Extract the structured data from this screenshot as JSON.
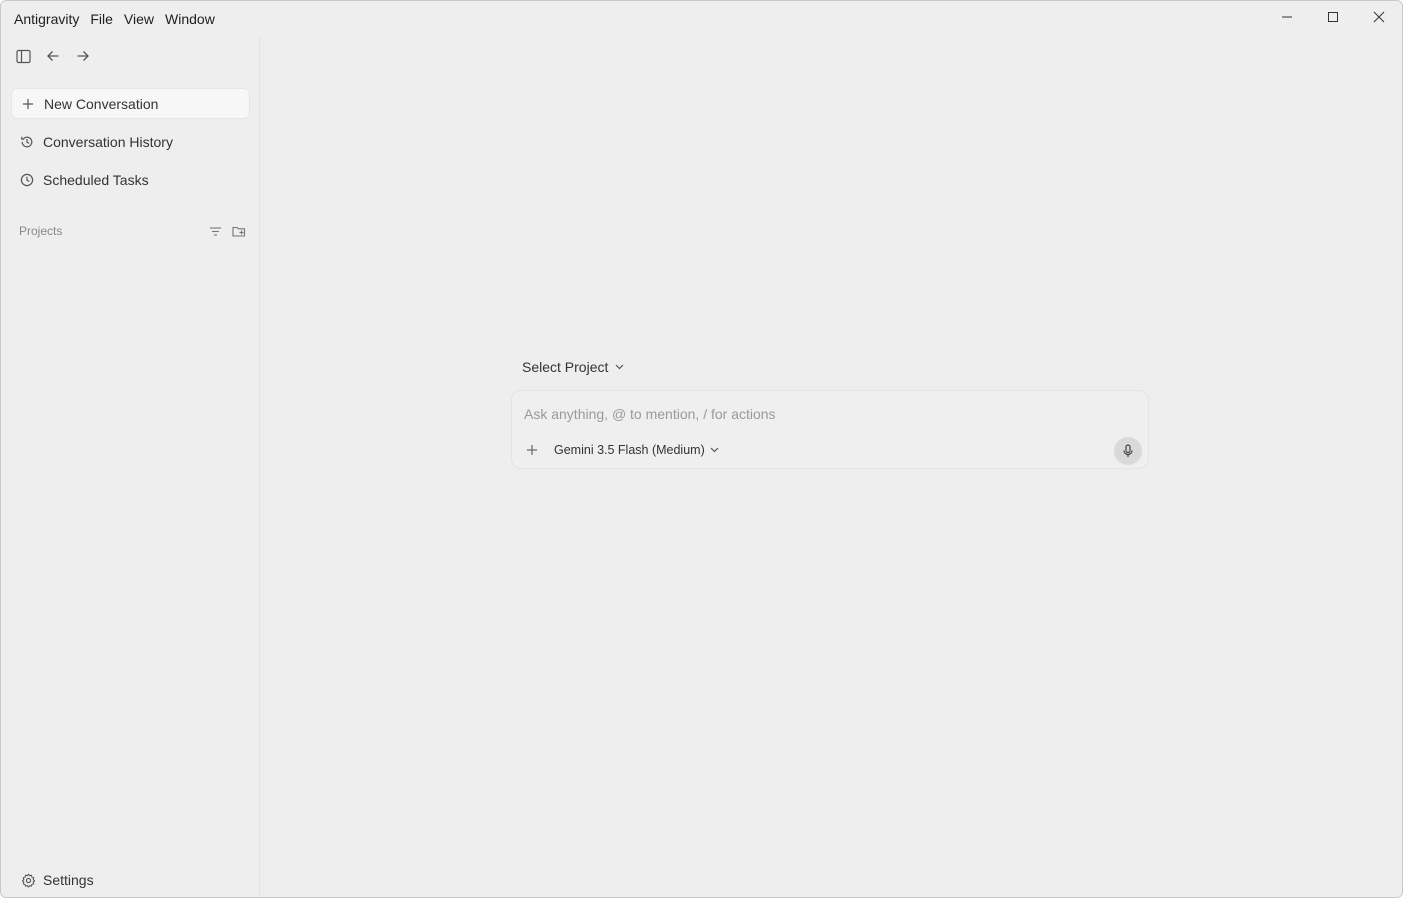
{
  "menu": {
    "app": "Antigravity",
    "items": [
      "File",
      "View",
      "Window"
    ]
  },
  "window_controls": {
    "minimize_icon": "minimize-icon",
    "maximize_icon": "maximize-icon",
    "close_icon": "close-icon"
  },
  "sidebar": {
    "toolbar_icons": [
      "sidebar-toggle-icon",
      "arrow-left-icon",
      "arrow-right-icon"
    ],
    "items": [
      {
        "label": "New Conversation",
        "icon": "plus-icon",
        "active": true
      },
      {
        "label": "Conversation History",
        "icon": "history-icon",
        "active": false
      },
      {
        "label": "Scheduled Tasks",
        "icon": "clock-icon",
        "active": false
      }
    ],
    "projects": {
      "label": "Projects",
      "icons": [
        "filter-icon",
        "new-folder-icon"
      ]
    },
    "settings": {
      "label": "Settings",
      "icon": "gear-icon"
    }
  },
  "main": {
    "select_project": "Select Project",
    "composer": {
      "placeholder": "Ask anything, @ to mention, / for actions",
      "value": "",
      "model": "Gemini 3.5 Flash (Medium)",
      "add_icon": "plus-icon",
      "mic_icon": "microphone-icon"
    }
  },
  "colors": {
    "background": "#eeeeee",
    "active_item": "#f7f7f7",
    "mic_button": "#d9d9d9",
    "edge_accent": "#3a9b5a"
  }
}
